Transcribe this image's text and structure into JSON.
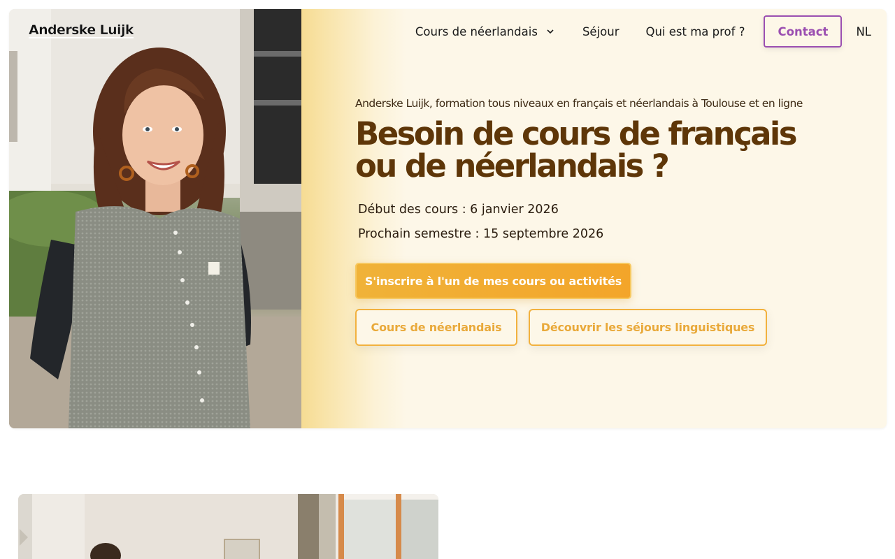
{
  "brand": {
    "logo_text": "Anderske Luijk"
  },
  "nav": {
    "items": [
      {
        "label": "Cours de néerlandais",
        "has_dropdown": true
      },
      {
        "label": "Séjour"
      },
      {
        "label": "Qui est ma prof ?"
      }
    ],
    "contact_label": "Contact",
    "language_label": "NL"
  },
  "hero": {
    "eyebrow": "Anderske Luijk, formation tous niveaux en français et néerlandais à Toulouse et en ligne",
    "headline_line1": "Besoin de cours de français",
    "headline_line2": "ou de néerlandais ?",
    "date_start": "Début des cours : 6 janvier 2026",
    "date_next": "Prochain semestre : 15 septembre 2026",
    "cta_primary": "S'inscrire à l'un de mes cours ou activités",
    "cta_dutch": "Cours de néerlandais",
    "cta_stays": "Découvrir les séjours linguistiques"
  },
  "colors": {
    "headline": "#5e3608",
    "accent_orange": "#f0b238",
    "contact_purple": "#9b4fb1",
    "hero_background": "#fdf7e8"
  }
}
